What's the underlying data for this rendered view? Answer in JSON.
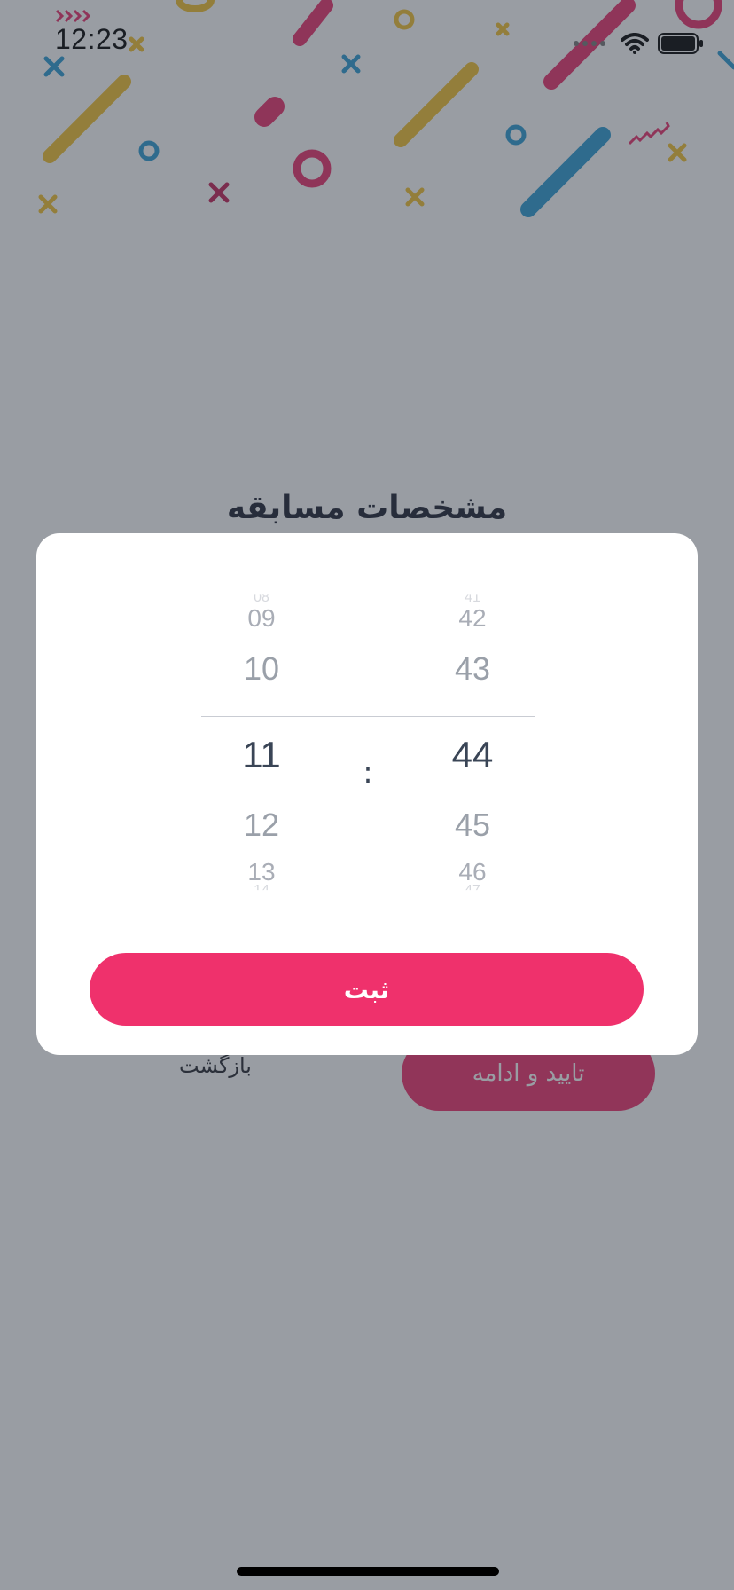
{
  "status_bar": {
    "time": "12:23"
  },
  "card": {
    "title": "مشخصات مسابقه",
    "back_label": "بازگشت",
    "confirm_label": "تایید و ادامه"
  },
  "time_picker": {
    "hours": [
      "08",
      "09",
      "10",
      "11",
      "12",
      "13",
      "14"
    ],
    "minutes": [
      "41",
      "42",
      "43",
      "44",
      "45",
      "46",
      "47"
    ],
    "separator": ":",
    "selected_hour": "11",
    "selected_minute": "44"
  },
  "modal": {
    "submit_label": "ثبت"
  },
  "colors": {
    "accent": "#ef316c",
    "text_dark": "#1b1f2e",
    "picker_text": "#3a4556",
    "overlay": "#343c48"
  }
}
